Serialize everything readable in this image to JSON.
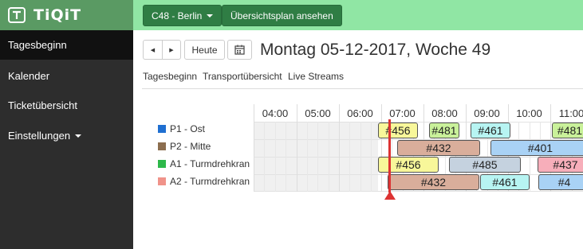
{
  "app": {
    "title": "TiQiT"
  },
  "sidebar": {
    "items": [
      {
        "label": "Tagesbeginn"
      },
      {
        "label": "Kalender"
      },
      {
        "label": "Ticketübersicht"
      },
      {
        "label": "Einstellungen"
      }
    ]
  },
  "topbar": {
    "site_label": "C48 - Berlin",
    "overview_label": "Übersichtsplan ansehen"
  },
  "toolbar": {
    "prev": "◀",
    "next": "▶",
    "today": "Heute",
    "date_title": "Montag 05-12-2017, Woche 49"
  },
  "tabs": [
    {
      "label": "Tagesbeginn"
    },
    {
      "label": "Transportübersicht"
    },
    {
      "label": "Live Streams"
    }
  ],
  "timeline": {
    "hours": [
      "04:00",
      "05:00",
      "06:00",
      "07:00",
      "08:00",
      "09:00",
      "10:00",
      "11:00"
    ],
    "resources": [
      {
        "label": "P1 - Ost",
        "color": "#1f6fd1"
      },
      {
        "label": "P2 - Mitte",
        "color": "#8c6e4f"
      },
      {
        "label": "A1 - Turmdrehkran",
        "color": "#2db84a"
      },
      {
        "label": "A2 - Turmdrehkran",
        "color": "#f0938a"
      }
    ],
    "bookings": [
      {
        "label": "#456",
        "color": "#f8f79a"
      },
      {
        "label": "#481",
        "color": "#c9f19a"
      },
      {
        "label": "#461",
        "color": "#b7f4f2"
      },
      {
        "label": "#481",
        "color": "#c9f19a"
      },
      {
        "label": "#432",
        "color": "#d9ae9b"
      },
      {
        "label": "#401",
        "color": "#a9d2f5"
      },
      {
        "label": "#456",
        "color": "#f8f79a"
      },
      {
        "label": "#485",
        "color": "#c5d2df"
      },
      {
        "label": "#437",
        "color": "#f7aeba"
      },
      {
        "label": "#432",
        "color": "#d9ae9b"
      },
      {
        "label": "#461",
        "color": "#b7f4f2"
      },
      {
        "label": "#4",
        "color": "#a9d2f5"
      }
    ]
  },
  "colors": {
    "topbar": "#90e6a4",
    "sidebar": "#2d2d2d",
    "logo_bar": "#5a9a63",
    "now_line": "#d33333"
  }
}
